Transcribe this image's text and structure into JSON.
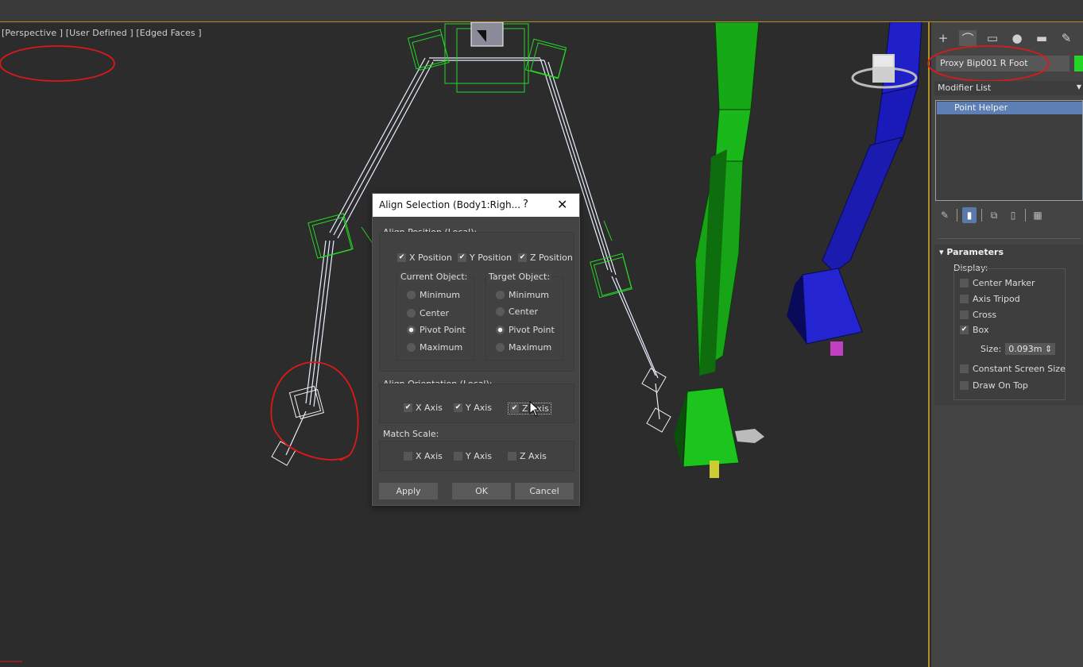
{
  "viewport": {
    "label": "[Perspective ] [User Defined ] [Edged Faces ]"
  },
  "command_panel": {
    "tabs": [
      "create-tab",
      "modify-tab",
      "hierarchy-tab",
      "motion-tab",
      "display-tab",
      "utilities-tab"
    ],
    "object_name": "Proxy Bip001 R Foot",
    "object_color": "#26d626",
    "modifier_list_label": "Modifier List",
    "stack_item": "Point Helper",
    "parameters": {
      "title": "Parameters",
      "display_label": "Display:",
      "center_marker": "Center Marker",
      "axis_tripod": "Axis Tripod",
      "cross": "Cross",
      "box": "Box",
      "size_label": "Size:",
      "size_value": "0.093m",
      "constant_screen_size": "Constant Screen Size",
      "draw_on_top": "Draw On Top"
    }
  },
  "dialog": {
    "title": "Align Selection (Body1:Righ...",
    "help_glyph": "?",
    "close_glyph": "✕",
    "align_position_label": "Align Position (Local):",
    "x_position": "X Position",
    "y_position": "Y Position",
    "z_position": "Z Position",
    "current_object_label": "Current Object:",
    "target_object_label": "Target Object:",
    "minimum": "Minimum",
    "center": "Center",
    "pivot_point": "Pivot Point",
    "maximum": "Maximum",
    "align_orientation_label": "Align Orientation (Local):",
    "x_axis": "X Axis",
    "y_axis": "Y Axis",
    "z_axis": "Z Axis",
    "match_scale_label": "Match Scale:",
    "apply": "Apply",
    "ok": "OK",
    "cancel": "Cancel"
  },
  "colors": {
    "accent_border": "#b08f2a",
    "selection_green": "#26d626",
    "stack_highlight": "#5d7fb5",
    "annotation_red": "#e01818"
  }
}
